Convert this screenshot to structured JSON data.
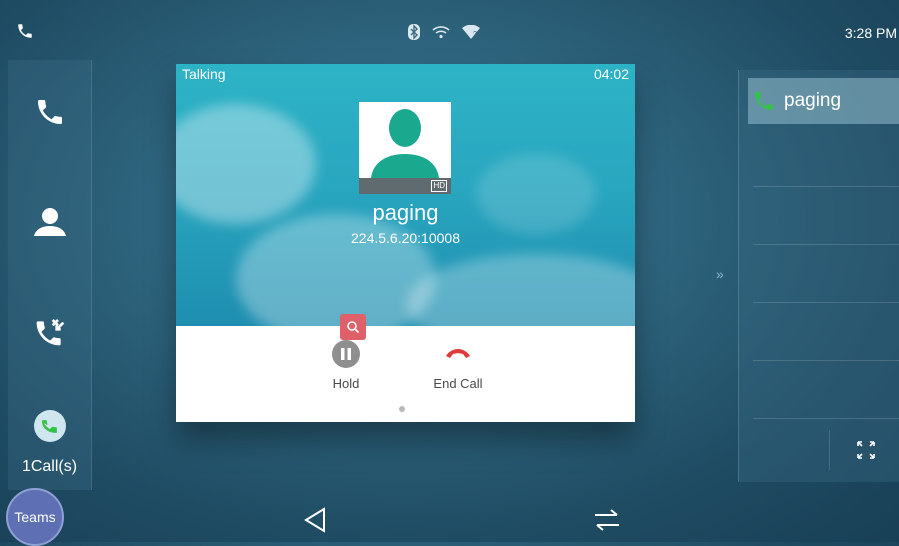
{
  "status_bar": {
    "time": "3:28 PM",
    "icons": [
      "phone-icon",
      "bluetooth-icon",
      "wifi-icon",
      "wifi-question-icon"
    ]
  },
  "sidebar": {
    "items": [
      {
        "name": "dial",
        "icon": "phone-icon"
      },
      {
        "name": "contacts",
        "icon": "contact-icon"
      },
      {
        "name": "history",
        "icon": "call-history-icon"
      },
      {
        "name": "calls",
        "icon": "active-call-icon"
      }
    ],
    "calls_count": "1Call(s)"
  },
  "call": {
    "status": "Talking",
    "timer": "04:02",
    "hd_badge": "HD",
    "name": "paging",
    "number": "224.5.6.20:10008",
    "actions": {
      "hold_label": "Hold",
      "end_label": "End Call"
    }
  },
  "right_panel": {
    "line_label": "paging",
    "chevrons": "»"
  },
  "bottom_bar": {
    "teams_label": "Teams"
  },
  "colors": {
    "end_call_red": "#e03a3a",
    "call_green": "#36c24a",
    "avatar_teal": "#1aa88f"
  }
}
